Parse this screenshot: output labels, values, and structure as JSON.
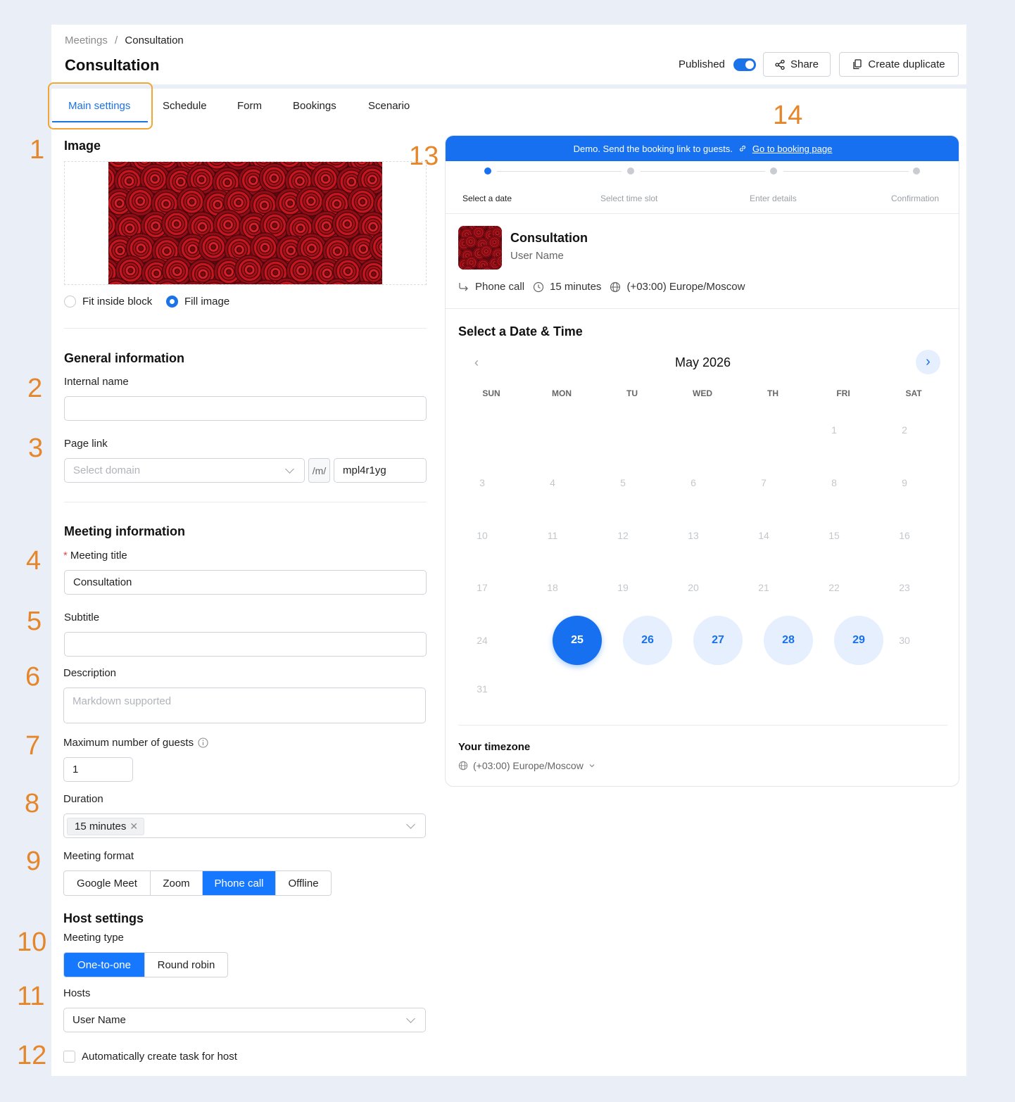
{
  "breadcrumb": {
    "parent": "Meetings",
    "separator": "/",
    "current": "Consultation"
  },
  "page_title": "Consultation",
  "header": {
    "published_label": "Published",
    "share_label": "Share",
    "duplicate_label": "Create duplicate"
  },
  "tabs": [
    "Main settings",
    "Schedule",
    "Form",
    "Bookings",
    "Scenario"
  ],
  "markers": [
    "1",
    "2",
    "3",
    "4",
    "5",
    "6",
    "7",
    "8",
    "9",
    "10",
    "11",
    "12",
    "13",
    "14"
  ],
  "image_section": {
    "title": "Image",
    "option_fit": "Fit inside block",
    "option_fill": "Fill image"
  },
  "general": {
    "title": "General information",
    "internal_name_label": "Internal name",
    "internal_name_value": "",
    "page_link_label": "Page link",
    "domain_placeholder": "Select domain",
    "link_sep": "/m/",
    "link_slug": "mpl4r1yg"
  },
  "meeting": {
    "title": "Meeting information",
    "required_mark": "*",
    "meeting_title_label": "Meeting title",
    "meeting_title_value": "Consultation",
    "subtitle_label": "Subtitle",
    "description_label": "Description",
    "description_placeholder": "Markdown supported",
    "guests_label": "Maximum number of guests",
    "guests_value": "1",
    "duration_label": "Duration",
    "duration_tag": "15 minutes",
    "format_label": "Meeting format",
    "formats": [
      "Google Meet",
      "Zoom",
      "Phone call",
      "Offline"
    ],
    "format_selected": "Phone call"
  },
  "host": {
    "title": "Host settings",
    "type_label": "Meeting type",
    "types": [
      "One-to-one",
      "Round robin"
    ],
    "type_selected": "One-to-one",
    "hosts_label": "Hosts",
    "hosts_value": "User Name",
    "auto_task_label": "Automatically create task for host"
  },
  "preview": {
    "demo_text": "Demo. Send the booking link to guests.",
    "demo_link": "Go to booking page",
    "steps": [
      "Select a date",
      "Select time slot",
      "Enter details",
      "Confirmation"
    ],
    "current_step": 0,
    "event_title": "Consultation",
    "host_name": "User Name",
    "format": "Phone call",
    "duration": "15 minutes",
    "timezone": "(+03:00) Europe/Moscow",
    "section_title": "Select a Date & Time",
    "month": "May 2026",
    "weekdays": [
      "SUN",
      "MON",
      "TU",
      "WED",
      "TH",
      "FRI",
      "SAT"
    ],
    "first_weekday_index": 5,
    "days_in_month": 31,
    "selected_day": 25,
    "available_days": [
      26,
      27,
      28,
      29
    ],
    "tz_title": "Your timezone",
    "tz_value": "(+03:00) Europe/Moscow"
  },
  "colors": {
    "accent": "#1670f0",
    "marker": "#e5862a",
    "highlight": "#f1a634"
  }
}
